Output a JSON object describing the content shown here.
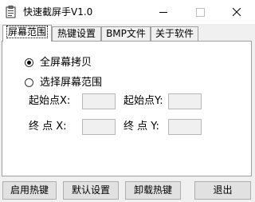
{
  "window": {
    "title": "快速截屏手V1.0"
  },
  "icons": {
    "app": "paste-clipboard-icon",
    "minimize": "minimize-icon",
    "maximize": "maximize-icon",
    "close": "close-icon"
  },
  "tabs": [
    {
      "label": "屏幕范围",
      "active": true
    },
    {
      "label": "热键设置",
      "active": false
    },
    {
      "label": "BMP文件",
      "active": false
    },
    {
      "label": "关于软件",
      "active": false
    }
  ],
  "screen_range": {
    "options": [
      {
        "label": "全屏幕拷贝",
        "selected": true
      },
      {
        "label": "选择屏幕范围",
        "selected": false
      }
    ],
    "start_x_label": "起始点X:",
    "start_y_label": "起始点Y:",
    "end_x_label": "终 点 X:",
    "end_y_label": "终 点 Y:"
  },
  "buttons": {
    "enable_hotkey": "启用热键",
    "default_settings": "默认设置",
    "unload_hotkey": "卸载热键",
    "exit": "退出"
  }
}
